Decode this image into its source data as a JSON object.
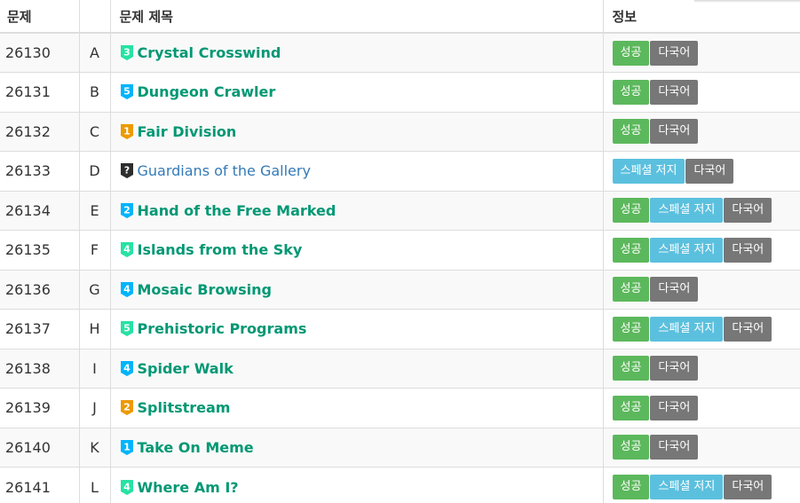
{
  "header": {
    "col_id": "문제",
    "col_letter": "",
    "col_title": "문제 제목",
    "col_info": "정보"
  },
  "tier_colors": {
    "bronze": "#ad5600",
    "silver": "#435f7a",
    "gold": "#ec9a00",
    "platinum": "#27e2a4",
    "diamond": "#00b4fc",
    "ruby": "#ff0062",
    "unrated": "#2d2d2d"
  },
  "badge_colors": {
    "success": "#5cb85c",
    "special": "#5bc0de",
    "multi": "#777777"
  },
  "problems": [
    {
      "id": "26130",
      "letter": "A",
      "tier_level": "3",
      "tier_class": "platinum",
      "title": "Crystal Crosswind",
      "solved": true,
      "tags": [
        {
          "kind": "success",
          "label": "성공"
        },
        {
          "kind": "multi",
          "label": "다국어"
        }
      ]
    },
    {
      "id": "26131",
      "letter": "B",
      "tier_level": "5",
      "tier_class": "diamond",
      "title": "Dungeon Crawler",
      "solved": true,
      "tags": [
        {
          "kind": "success",
          "label": "성공"
        },
        {
          "kind": "multi",
          "label": "다국어"
        }
      ]
    },
    {
      "id": "26132",
      "letter": "C",
      "tier_level": "1",
      "tier_class": "gold",
      "title": "Fair Division",
      "solved": true,
      "tags": [
        {
          "kind": "success",
          "label": "성공"
        },
        {
          "kind": "multi",
          "label": "다국어"
        }
      ]
    },
    {
      "id": "26133",
      "letter": "D",
      "tier_level": "?",
      "tier_class": "unrated",
      "title": "Guardians of the Gallery",
      "solved": false,
      "tags": [
        {
          "kind": "special",
          "label": "스페셜 저지"
        },
        {
          "kind": "multi",
          "label": "다국어"
        }
      ]
    },
    {
      "id": "26134",
      "letter": "E",
      "tier_level": "2",
      "tier_class": "diamond",
      "title": "Hand of the Free Marked",
      "solved": true,
      "tags": [
        {
          "kind": "success",
          "label": "성공"
        },
        {
          "kind": "special",
          "label": "스페셜 저지"
        },
        {
          "kind": "multi",
          "label": "다국어"
        }
      ]
    },
    {
      "id": "26135",
      "letter": "F",
      "tier_level": "4",
      "tier_class": "platinum",
      "title": "Islands from the Sky",
      "solved": true,
      "tags": [
        {
          "kind": "success",
          "label": "성공"
        },
        {
          "kind": "special",
          "label": "스페셜 저지"
        },
        {
          "kind": "multi",
          "label": "다국어"
        }
      ]
    },
    {
      "id": "26136",
      "letter": "G",
      "tier_level": "4",
      "tier_class": "diamond",
      "title": "Mosaic Browsing",
      "solved": true,
      "tags": [
        {
          "kind": "success",
          "label": "성공"
        },
        {
          "kind": "multi",
          "label": "다국어"
        }
      ]
    },
    {
      "id": "26137",
      "letter": "H",
      "tier_level": "5",
      "tier_class": "platinum",
      "title": "Prehistoric Programs",
      "solved": true,
      "tags": [
        {
          "kind": "success",
          "label": "성공"
        },
        {
          "kind": "special",
          "label": "스페셜 저지"
        },
        {
          "kind": "multi",
          "label": "다국어"
        }
      ]
    },
    {
      "id": "26138",
      "letter": "I",
      "tier_level": "4",
      "tier_class": "diamond",
      "title": "Spider Walk",
      "solved": true,
      "tags": [
        {
          "kind": "success",
          "label": "성공"
        },
        {
          "kind": "multi",
          "label": "다국어"
        }
      ]
    },
    {
      "id": "26139",
      "letter": "J",
      "tier_level": "2",
      "tier_class": "gold",
      "title": "Splitstream",
      "solved": true,
      "tags": [
        {
          "kind": "success",
          "label": "성공"
        },
        {
          "kind": "multi",
          "label": "다국어"
        }
      ]
    },
    {
      "id": "26140",
      "letter": "K",
      "tier_level": "1",
      "tier_class": "diamond",
      "title": "Take On Meme",
      "solved": true,
      "tags": [
        {
          "kind": "success",
          "label": "성공"
        },
        {
          "kind": "multi",
          "label": "다국어"
        }
      ]
    },
    {
      "id": "26141",
      "letter": "L",
      "tier_level": "4",
      "tier_class": "platinum",
      "title": "Where Am I?",
      "solved": true,
      "tags": [
        {
          "kind": "success",
          "label": "성공"
        },
        {
          "kind": "special",
          "label": "스페셜 저지"
        },
        {
          "kind": "multi",
          "label": "다국어"
        }
      ]
    }
  ]
}
